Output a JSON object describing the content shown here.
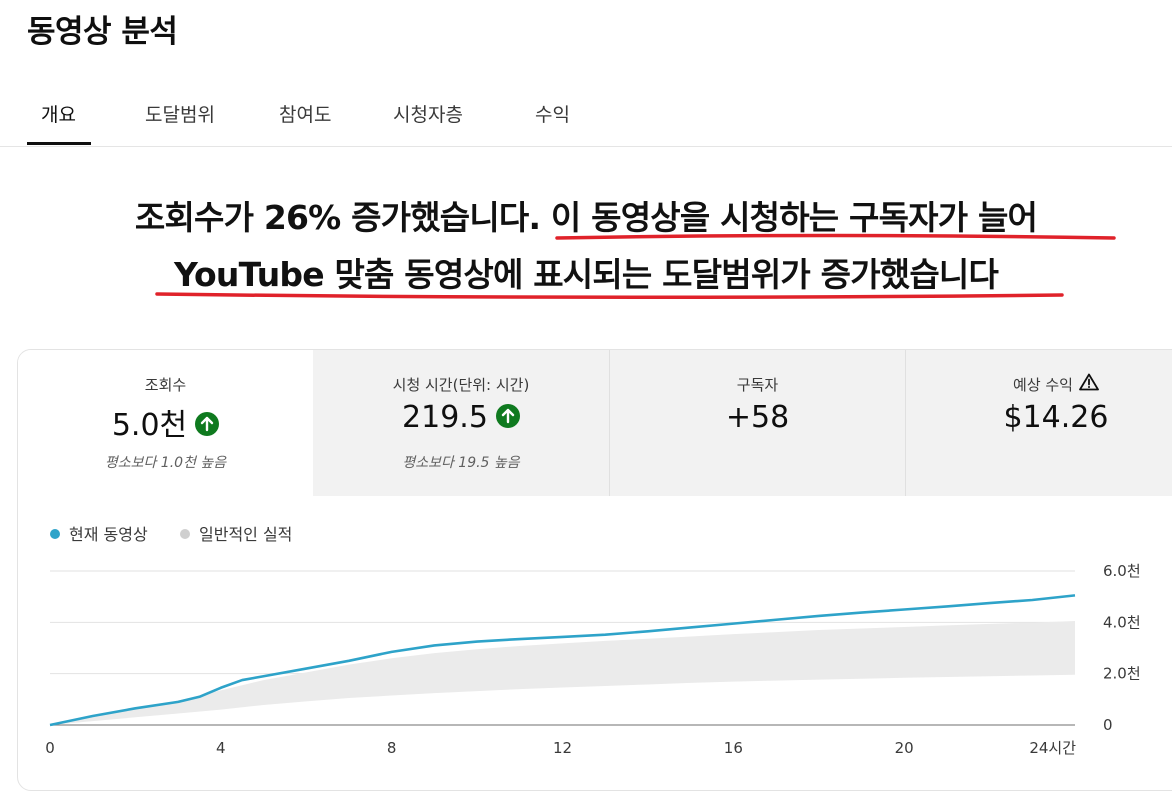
{
  "page": {
    "title": "동영상 분석"
  },
  "tabs": [
    {
      "label": "개요",
      "active": true
    },
    {
      "label": "도달범위",
      "active": false
    },
    {
      "label": "참여도",
      "active": false
    },
    {
      "label": "시청자층",
      "active": false
    },
    {
      "label": "수익",
      "active": false
    }
  ],
  "caption": {
    "line1": "조회수가 26% 증가했습니다. 이 동영상을 시청하는 구독자가 늘어",
    "line2": "YouTube 맞춤 동영상에 표시되는 도달범위가 증가했습니다"
  },
  "metrics": [
    {
      "label": "조회수",
      "value": "5.0천",
      "trend_icon": "arrow-up-circle-icon",
      "sub": "평소보다 1.0천 높음"
    },
    {
      "label": "시청 시간(단위: 시간)",
      "value": "219.5",
      "trend_icon": "arrow-up-circle-icon",
      "sub": "평소보다 19.5 높음"
    },
    {
      "label": "구독자",
      "value": "+58"
    },
    {
      "label": "예상 수익",
      "value": "$14.26",
      "info_icon": "warning-icon"
    }
  ],
  "legend": [
    {
      "label": "현재 동영상",
      "color": "#2ea3c9"
    },
    {
      "label": "일반적인 실적",
      "color": "#cfcfcf"
    }
  ],
  "colors": {
    "current_line": "#2ea3c9",
    "typical_band": "#ebebeb",
    "trend_up": "#0f7a1f",
    "caption_underline": "#e0222a"
  },
  "chart_data": {
    "type": "area",
    "xlim": [
      0,
      24
    ],
    "ylim": [
      0,
      6000
    ],
    "x_ticks": [
      "0",
      "4",
      "8",
      "12",
      "16",
      "20",
      "24시간"
    ],
    "x_tick_values": [
      0,
      4,
      8,
      12,
      16,
      20,
      24
    ],
    "y_ticks": [
      "0",
      "2.0천",
      "4.0천",
      "6.0천"
    ],
    "y_tick_values": [
      0,
      2000,
      4000,
      6000
    ],
    "grid": true,
    "series": [
      {
        "name": "현재 동영상",
        "x": [
          0,
          1,
          2,
          3,
          3.5,
          4,
          4.5,
          5,
          6,
          7,
          8,
          9,
          10,
          11,
          12,
          13,
          14,
          15,
          16,
          17,
          18,
          19,
          20,
          21,
          22,
          23,
          24
        ],
        "values": [
          0,
          350,
          650,
          900,
          1100,
          1450,
          1750,
          1900,
          2200,
          2500,
          2850,
          3100,
          3250,
          3350,
          3430,
          3520,
          3650,
          3800,
          3950,
          4100,
          4250,
          4380,
          4500,
          4620,
          4750,
          4870,
          5050
        ]
      },
      {
        "name": "일반적인 실적",
        "x": [
          0,
          1,
          2,
          3,
          4,
          5,
          6,
          7,
          8,
          9,
          10,
          11,
          12,
          13,
          14,
          15,
          16,
          17,
          18,
          19,
          20,
          21,
          22,
          23,
          24
        ],
        "upper": [
          0,
          300,
          620,
          950,
          1350,
          1750,
          2050,
          2350,
          2600,
          2800,
          2950,
          3080,
          3180,
          3280,
          3360,
          3450,
          3540,
          3620,
          3700,
          3760,
          3820,
          3880,
          3940,
          3990,
          4050
        ],
        "lower": [
          0,
          150,
          300,
          450,
          600,
          780,
          920,
          1050,
          1150,
          1240,
          1320,
          1400,
          1460,
          1520,
          1580,
          1640,
          1690,
          1730,
          1770,
          1800,
          1840,
          1870,
          1900,
          1930,
          1960
        ]
      }
    ]
  }
}
